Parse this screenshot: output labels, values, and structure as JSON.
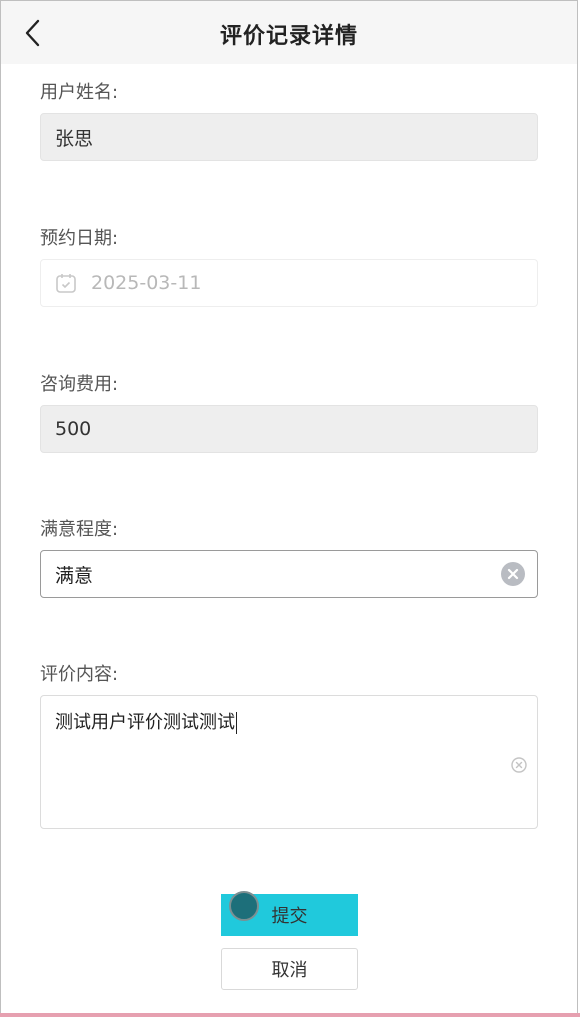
{
  "header": {
    "title": "评价记录详情",
    "back_icon": "chevron-left-icon"
  },
  "form": {
    "user_name": {
      "label": "用户姓名:",
      "value": "张思"
    },
    "appointment_date": {
      "label": "预约日期:",
      "value": "2025-03-11",
      "icon": "calendar-icon"
    },
    "consult_fee": {
      "label": "咨询费用:",
      "value": "500"
    },
    "satisfaction": {
      "label": "满意程度:",
      "value": "满意",
      "clear_icon": "clear-icon"
    },
    "review_content": {
      "label": "评价内容:",
      "value": "测试用户评价测试测试"
    }
  },
  "actions": {
    "submit_label": "提交",
    "cancel_label": "取消",
    "submit_color": "#20c9dc"
  }
}
